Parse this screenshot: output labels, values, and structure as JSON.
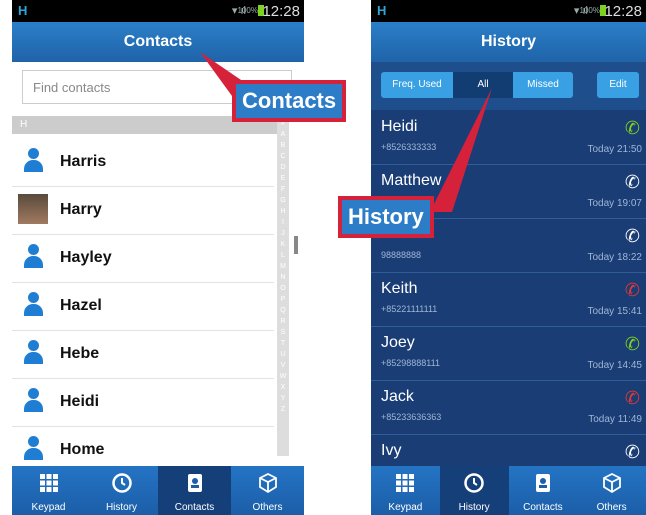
{
  "left": {
    "status": {
      "signal": "▾ ıl",
      "pct": "100%",
      "time": "12:28"
    },
    "title": "Contacts",
    "search_placeholder": "Find contacts",
    "section": "H",
    "contacts": [
      {
        "name": "Harris",
        "avatar": "person-icon"
      },
      {
        "name": "Harry",
        "avatar": "photo"
      },
      {
        "name": "Hayley",
        "avatar": "person-icon"
      },
      {
        "name": "Hazel",
        "avatar": "person-icon"
      },
      {
        "name": "Hebe",
        "avatar": "person-icon"
      },
      {
        "name": "Heidi",
        "avatar": "person-icon"
      },
      {
        "name": "Home",
        "avatar": "person-icon"
      }
    ],
    "alphabet": [
      "#",
      "A",
      "B",
      "C",
      "D",
      "E",
      "F",
      "G",
      "H",
      "I",
      "J",
      "K",
      "L",
      "M",
      "N",
      "O",
      "P",
      "Q",
      "R",
      "S",
      "T",
      "U",
      "V",
      "W",
      "X",
      "Y",
      "Z"
    ]
  },
  "right": {
    "status": {
      "signal": "▾ ıl",
      "pct": "100%",
      "time": "12:28"
    },
    "title": "History",
    "segments": [
      "Freq. Used",
      "All",
      "Missed",
      "Edit"
    ],
    "entries": [
      {
        "name": "Heidi",
        "number": "+8526333333",
        "time": "Today 21:50",
        "type": "outgoing"
      },
      {
        "name": "Matthew",
        "number": "",
        "time": "Today 19:07",
        "type": "incoming"
      },
      {
        "name": "",
        "number": "98888888",
        "time": "Today 18:22",
        "type": "incoming"
      },
      {
        "name": "Keith",
        "number": "+85221111111",
        "time": "Today 15:41",
        "type": "missed"
      },
      {
        "name": "Joey",
        "number": "+85298888111",
        "time": "Today 14:45",
        "type": "outgoing"
      },
      {
        "name": "Jack",
        "number": "+85233636363",
        "time": "Today 11:49",
        "type": "missed"
      },
      {
        "name": "Ivy",
        "number": "",
        "time": "",
        "type": "incoming"
      }
    ]
  },
  "tabs": [
    "Keypad",
    "History",
    "Contacts",
    "Others"
  ],
  "callouts": {
    "contacts": "Contacts",
    "history": "History"
  },
  "colors": {
    "accent": "#2b7fc9",
    "callout_border": "#d6213a",
    "history_bg": "#1a3d75"
  }
}
